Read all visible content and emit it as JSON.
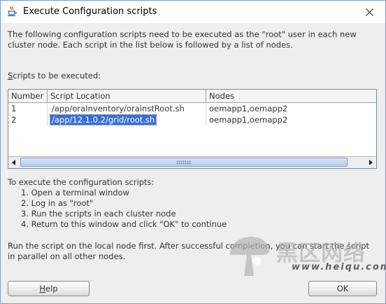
{
  "window": {
    "title": "Execute Configuration scripts"
  },
  "intro": {
    "line1": "The following configuration scripts need to be executed as the \"root\" user in each new",
    "line2": "cluster node. Each script in the list below is followed by a list of nodes."
  },
  "scripts_label": "Scripts to be executed:",
  "table": {
    "columns": [
      "Number",
      "Script Location",
      "Nodes"
    ],
    "rows": [
      {
        "number": "1",
        "location": "/app/oraInventory/orainstRoot.sh",
        "nodes": "oemapp1,oemapp2"
      },
      {
        "number": "2",
        "location": "/app/12.1.0.2/grid/root.sh",
        "nodes": "oemapp1,oemapp2"
      }
    ],
    "selected_row": 2
  },
  "instructions": {
    "heading": "To execute the configuration scripts:",
    "steps": [
      "1. Open a terminal window",
      "2. Log in as \"root\"",
      "3. Run the scripts in each cluster node",
      "4. Return to this window and click \"OK\" to continue"
    ]
  },
  "note": {
    "line1": "Run the script on the local node first. After successful completion, you can start the script",
    "line2": "in parallel on all other nodes."
  },
  "buttons": {
    "help": "Help",
    "ok": "OK"
  },
  "watermark": {
    "text": "黑区网络",
    "url": "www.heiqu.com"
  },
  "colors": {
    "selection": "#3b6fd6",
    "scroll_thumb": "#b5cde9",
    "window_border": "#7a9cc9"
  }
}
